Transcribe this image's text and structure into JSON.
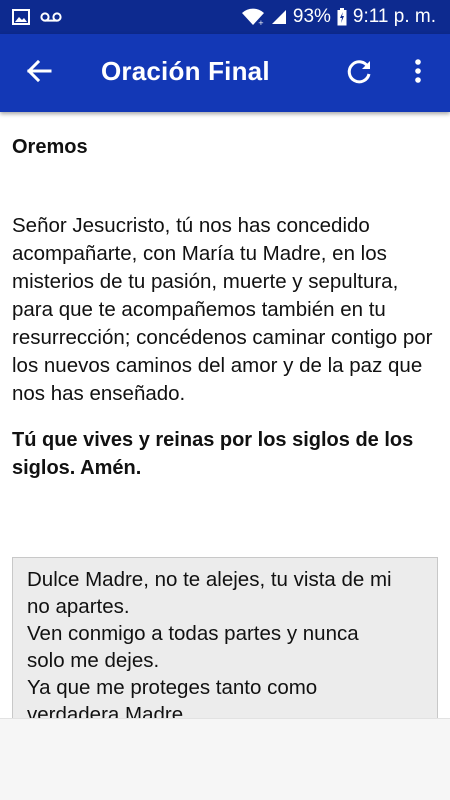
{
  "status_bar": {
    "battery": "93%",
    "time": "9:11 p. m.",
    "icons": [
      "image-icon",
      "voicemail-icon",
      "wifi-icon",
      "signal-icon",
      "battery-icon"
    ]
  },
  "app_bar": {
    "title": "Oración Final",
    "icons": [
      "back-arrow-icon",
      "refresh-icon",
      "more-vert-icon"
    ],
    "color": "#1338b6",
    "status_color": "#0d2a8f"
  },
  "content": {
    "heading": "Oremos",
    "prayer": "Señor Jesucristo, tú nos has concedido acompañarte, con María tu Madre, en los misterios de tu pasión, muerte y sepultura, para que te acompañemos también en tu resurrección; concédenos caminar contigo por los nuevos caminos del amor y de la paz que nos has enseñado.",
    "closing": "Tú que vives y reinas por los siglos de los siglos. Amén."
  },
  "box": {
    "lines": [
      "Dulce Madre, no te alejes, tu vista de mi",
      "no apartes.",
      "Ven conmigo a todas partes y nunca",
      "solo me dejes.",
      "Ya que me proteges tanto como",
      "verdadera Madre."
    ]
  }
}
